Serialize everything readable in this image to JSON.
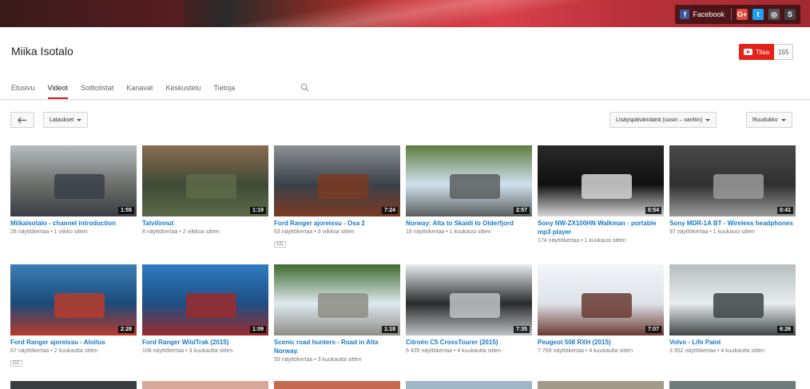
{
  "social": {
    "facebook_label": "Facebook"
  },
  "channel": {
    "name": "Miika Isotalo",
    "subscribe_label": "Tilaa",
    "subscriber_count": "155"
  },
  "tabs": [
    {
      "label": "Etusivu"
    },
    {
      "label": "Videot"
    },
    {
      "label": "Soittolistat"
    },
    {
      "label": "Kanavat"
    },
    {
      "label": "Keskustelu"
    },
    {
      "label": "Tietoja"
    }
  ],
  "toolbar": {
    "filter_label": "Lataukset",
    "sort_label": "Lisäyspäivämäärä (uusin – vanhin)",
    "view_label": "Ruudukko"
  },
  "videos": [
    {
      "title": "Miikalsotalo - channel introduction",
      "duration": "1:55",
      "meta": "28 näyttökertaa • 1 viikko sitten",
      "cc": "",
      "colors": [
        "#6b6e6a",
        "#b7bcbf",
        "#3a3f46"
      ]
    },
    {
      "title": "Talvilinnut",
      "duration": "1:19",
      "meta": "8 näyttökertaa • 2 viikkoa sitten",
      "cc": "",
      "colors": [
        "#3f4a36",
        "#8a6b52",
        "#5d6b4a"
      ]
    },
    {
      "title": "Ford Ranger ajoreissu - Osa 2",
      "duration": "7:24",
      "meta": "63 näyttökertaa • 3 viikkoa sitten",
      "cc": "CC",
      "colors": [
        "#3b4148",
        "#8d9196",
        "#7a3a22"
      ]
    },
    {
      "title": "Norway: Alta to Skaidi to Olderfjord",
      "duration": "2:57",
      "meta": "18 näyttökertaa • 1 kuukausi sitten",
      "cc": "",
      "colors": [
        "#cfe1ee",
        "#5f7d3f",
        "#5a5e5f"
      ]
    },
    {
      "title": "Sony NW-ZX100HN Walkman - portable mp3 player",
      "duration": "0:54",
      "meta": "174 näyttökertaa • 1 kuukausi sitten",
      "cc": "",
      "colors": [
        "#101010",
        "#2a2a2a",
        "#d6d6d6"
      ]
    },
    {
      "title": "Sony MDR-1A BT - Wireless headphones",
      "duration": "0:41",
      "meta": "97 näyttökertaa • 1 kuukausi sitten",
      "cc": "",
      "colors": [
        "#2f2f2f",
        "#4a4a4a",
        "#9a9a9a"
      ]
    },
    {
      "title": "Ford Ranger ajoreissu - Aloitus",
      "duration": "2:28",
      "meta": "67 näyttökertaa • 2 kuukautta sitten",
      "cc": "CC",
      "colors": [
        "#1a4a7a",
        "#3c7fb6",
        "#b83a2a"
      ]
    },
    {
      "title": "Ford Ranger WildTrak (2015)",
      "duration": "1:09",
      "meta": "108 näyttökertaa • 3 kuukautta sitten",
      "cc": "",
      "colors": [
        "#1d4f86",
        "#2f7bc0",
        "#9b2a2a"
      ]
    },
    {
      "title": "Scenic road hunters - Road in Alta Norway.",
      "duration": "1:18",
      "meta": "59 näyttökertaa • 3 kuukautta sitten",
      "cc": "",
      "colors": [
        "#dfe9ef",
        "#3e6a2e",
        "#8e8d86"
      ]
    },
    {
      "title": "Citroën C5 CrossTourer (2015)",
      "duration": "7:35",
      "meta": "5 435 näyttökertaa • 4 kuukautta sitten",
      "cc": "",
      "colors": [
        "#2b2b2b",
        "#e8ecef",
        "#bfc3c6"
      ]
    },
    {
      "title": "Peugeot 508 RXH (2015)",
      "duration": "7:07",
      "meta": "7 769 näyttökertaa • 4 kuukautta sitten",
      "cc": "",
      "colors": [
        "#dde3e8",
        "#f3f5f7",
        "#6a3a32"
      ]
    },
    {
      "title": "Volvo - Life Paint",
      "duration": "6:26",
      "meta": "3 952 näyttökertaa • 4 kuukautta sitten",
      "cc": "",
      "colors": [
        "#e9ecec",
        "#b7c0bf",
        "#3e4544"
      ]
    }
  ]
}
